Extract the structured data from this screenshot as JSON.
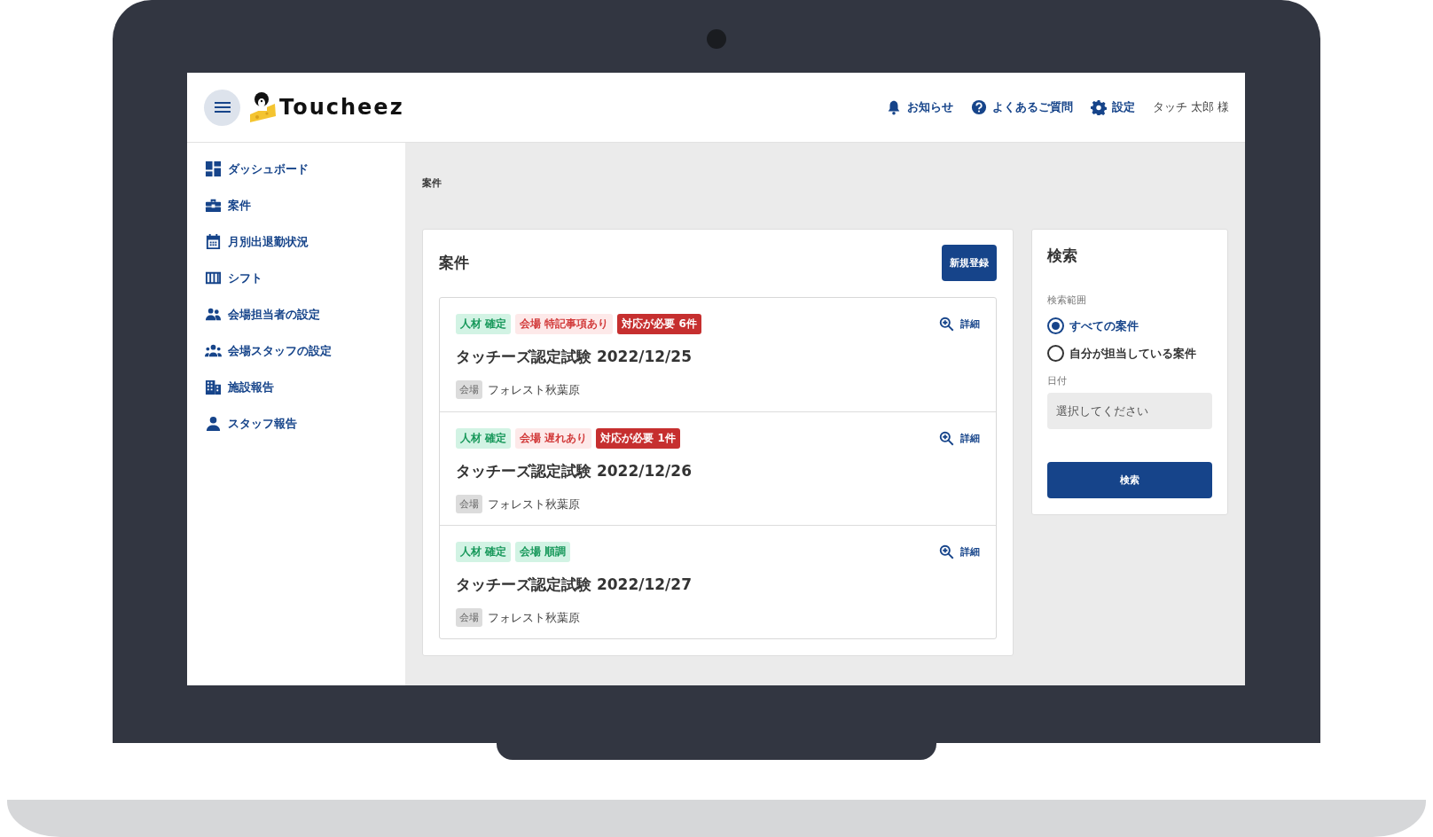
{
  "header": {
    "logo_text": "Toucheez",
    "links": [
      {
        "label": "お知らせ"
      },
      {
        "label": "よくあるご質問"
      },
      {
        "label": "設定"
      }
    ],
    "user": "タッチ 太郎 様"
  },
  "sidebar": {
    "items": [
      {
        "label": "ダッシュボード"
      },
      {
        "label": "案件"
      },
      {
        "label": "月別出退勤状況"
      },
      {
        "label": "シフト"
      },
      {
        "label": "会場担当者の設定"
      },
      {
        "label": "会場スタッフの設定"
      },
      {
        "label": "施設報告"
      },
      {
        "label": "スタッフ報告"
      }
    ]
  },
  "breadcrumb": "案件",
  "cases_panel": {
    "title": "案件",
    "new_button": "新規登録",
    "cases": [
      {
        "tags": [
          {
            "label": "人材 確定",
            "kind": "ok"
          },
          {
            "label": "会場 特記事項あり",
            "kind": "caution"
          },
          {
            "label": "対応が必要 6件",
            "kind": "alert"
          }
        ],
        "detail": "詳細",
        "title": "タッチーズ認定試験 2022/12/25",
        "venue_label": "会場",
        "venue": "フォレスト秋葉原"
      },
      {
        "tags": [
          {
            "label": "人材 確定",
            "kind": "ok"
          },
          {
            "label": "会場 遅れあり",
            "kind": "caution"
          },
          {
            "label": "対応が必要 1件",
            "kind": "alert"
          }
        ],
        "detail": "詳細",
        "title": "タッチーズ認定試験 2022/12/26",
        "venue_label": "会場",
        "venue": "フォレスト秋葉原"
      },
      {
        "tags": [
          {
            "label": "人材 確定",
            "kind": "ok"
          },
          {
            "label": "会場 順調",
            "kind": "ok"
          }
        ],
        "detail": "詳細",
        "title": "タッチーズ認定試験 2022/12/27",
        "venue_label": "会場",
        "venue": "フォレスト秋葉原"
      }
    ]
  },
  "search_panel": {
    "title": "検索",
    "scope_label": "検索範囲",
    "scope_options": [
      {
        "label": "すべての案件",
        "selected": true
      },
      {
        "label": "自分が担当している案件",
        "selected": false
      }
    ],
    "date_label": "日付",
    "date_field": {
      "placeholder": "選択してください"
    },
    "search_button": "検索"
  }
}
